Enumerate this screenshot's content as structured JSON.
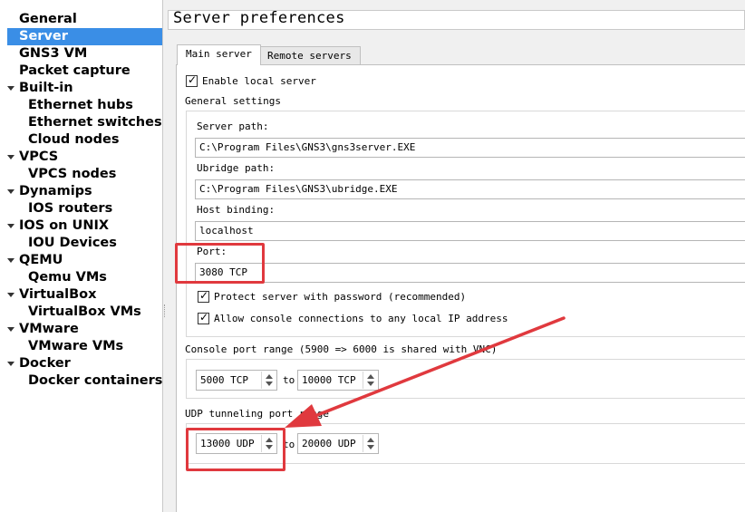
{
  "sidebar": {
    "items": [
      {
        "label": "General",
        "level": 0
      },
      {
        "label": "Server",
        "level": 0,
        "selected": true
      },
      {
        "label": "GNS3 VM",
        "level": 0
      },
      {
        "label": "Packet capture",
        "level": 0
      },
      {
        "label": "Built-in",
        "level": 0,
        "expander": true
      },
      {
        "label": "Ethernet hubs",
        "level": 1
      },
      {
        "label": "Ethernet switches",
        "level": 1
      },
      {
        "label": "Cloud nodes",
        "level": 1
      },
      {
        "label": "VPCS",
        "level": 0,
        "expander": true
      },
      {
        "label": "VPCS nodes",
        "level": 1
      },
      {
        "label": "Dynamips",
        "level": 0,
        "expander": true
      },
      {
        "label": "IOS routers",
        "level": 1
      },
      {
        "label": "IOS on UNIX",
        "level": 0,
        "expander": true
      },
      {
        "label": "IOU Devices",
        "level": 1
      },
      {
        "label": "QEMU",
        "level": 0,
        "expander": true
      },
      {
        "label": "Qemu VMs",
        "level": 1
      },
      {
        "label": "VirtualBox",
        "level": 0,
        "expander": true
      },
      {
        "label": "VirtualBox VMs",
        "level": 1
      },
      {
        "label": "VMware",
        "level": 0,
        "expander": true
      },
      {
        "label": "VMware VMs",
        "level": 1
      },
      {
        "label": "Docker",
        "level": 0,
        "expander": true
      },
      {
        "label": "Docker containers",
        "level": 1
      }
    ]
  },
  "page": {
    "title": "Server preferences"
  },
  "tabs": {
    "main": "Main server",
    "remote": "Remote servers"
  },
  "main_server": {
    "enable_local_server": "Enable local server",
    "general_settings": "General settings",
    "server_path_label": "Server path:",
    "server_path_value": "C:\\Program Files\\GNS3\\gns3server.EXE",
    "ubridge_path_label": "Ubridge path:",
    "ubridge_path_value": "C:\\Program Files\\GNS3\\ubridge.EXE",
    "host_binding_label": "Host binding:",
    "host_binding_value": "localhost",
    "port_label": "Port:",
    "port_value": "3080 TCP",
    "protect_server": "Protect server with password (recommended)",
    "allow_console": "Allow console connections to any local IP address",
    "console_range_label": "Console port range (5900 => 6000 is shared with VNC)",
    "console_start": "5000 TCP",
    "console_to": "to",
    "console_end": "10000 TCP",
    "udp_range_label": "UDP tunneling port range",
    "udp_start": "13000 UDP",
    "udp_to": "to",
    "udp_end": "20000 UDP"
  },
  "colors": {
    "selection": "#3a8ee6",
    "annotation": "#e0393e"
  },
  "icons": [
    "expander-arrow-icon",
    "checkbox-check-icon",
    "spin-up-icon",
    "spin-down-icon"
  ]
}
